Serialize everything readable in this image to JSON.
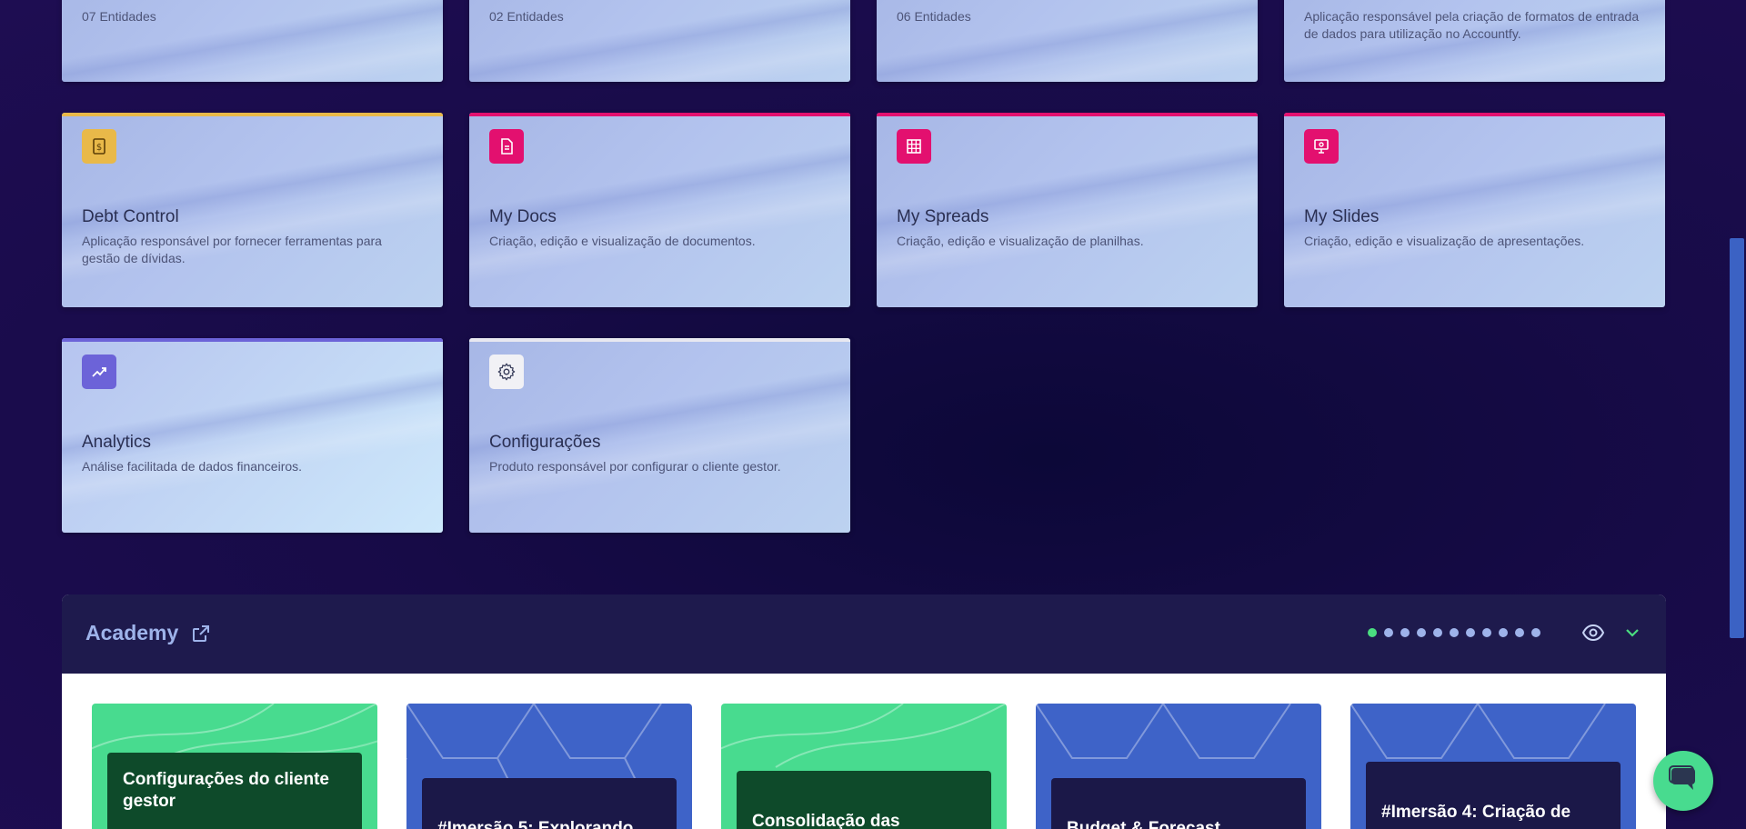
{
  "cards_top_partial": [
    {
      "subtitle": "07 Entidades"
    },
    {
      "subtitle": "02 Entidades"
    },
    {
      "subtitle": "06 Entidades"
    },
    {
      "subtitle": "Aplicação responsável pela criação de formatos de entrada de dados para utilização no Accountfy."
    }
  ],
  "cards": [
    {
      "title": "Debt Control",
      "desc": "Aplicação responsável por fornecer ferramentas para gestão de dívidas.",
      "icon": "debt-icon",
      "accent": "#e9b949"
    },
    {
      "title": "My Docs",
      "desc": "Criação, edição e visualização de documentos.",
      "icon": "document-icon",
      "accent": "#e3106f"
    },
    {
      "title": "My Spreads",
      "desc": "Criação, edição e visualização de planilhas.",
      "icon": "spreadsheet-icon",
      "accent": "#e3106f"
    },
    {
      "title": "My Slides",
      "desc": "Criação, edição e visualização de apresentações.",
      "icon": "presentation-icon",
      "accent": "#e3106f"
    },
    {
      "title": "Analytics",
      "desc": "Análise facilitada de dados financeiros.",
      "icon": "trending-up-icon",
      "accent": "#6c63d8"
    },
    {
      "title": "Configurações",
      "desc": "Produto responsável por configurar o cliente gestor.",
      "icon": "gear-icon",
      "accent": "#e8e8f0"
    }
  ],
  "academy": {
    "title": "Academy",
    "courses": [
      {
        "title": "Configurações do cliente gestor",
        "theme": "green"
      },
      {
        "title": "#Imersão 5: Explorando",
        "theme": "blue"
      },
      {
        "title": "Consolidação das",
        "theme": "green"
      },
      {
        "title": "Budget & Forecast",
        "theme": "blue"
      },
      {
        "title": "#Imersão 4: Criação de",
        "theme": "blue"
      }
    ],
    "carousel_dots": 11,
    "active_dot": 0
  },
  "colors": {
    "background": "#170b47",
    "academy_header": "#1e1a4d",
    "academy_title": "#9eb3ea",
    "green": "#48db8f",
    "blue": "#3e63c8"
  }
}
